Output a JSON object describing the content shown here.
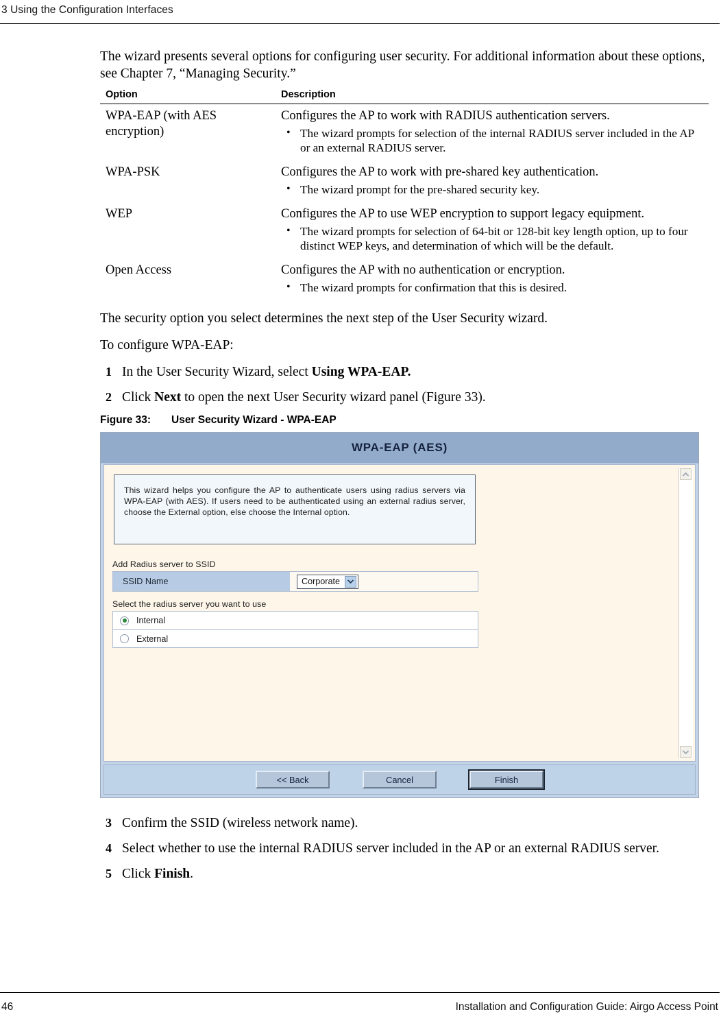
{
  "header": {
    "chapter_number": "3",
    "chapter_title": "Using the Configuration Interfaces",
    "full": "3  Using the Configuration Interfaces"
  },
  "intro": {
    "paragraph": "The wizard presents several options for configuring user security. For additional information about these options, see Chapter 7,  “Managing Security.”"
  },
  "options_table": {
    "headers": {
      "option": "Option",
      "description": "Description"
    },
    "rows": [
      {
        "option": "WPA-EAP (with AES encryption)",
        "description_lead": "Configures the AP to work with RADIUS authentication servers.",
        "bullets": [
          "The wizard prompts for selection of the internal RADIUS server included in the AP or an external RADIUS server."
        ]
      },
      {
        "option": "WPA-PSK",
        "description_lead": "Configures the AP to work with pre-shared key authentication.",
        "bullets": [
          "The wizard prompt for the pre-shared security key."
        ]
      },
      {
        "option": "WEP",
        "description_lead": "Configures the AP to use WEP encryption to support legacy equipment.",
        "bullets": [
          "The wizard prompts for selection of 64-bit or 128-bit key length option, up to four distinct WEP keys, and determination of which will be the default."
        ]
      },
      {
        "option": "Open Access",
        "description_lead": "Configures the AP with no authentication or encryption.",
        "bullets": [
          "The wizard prompts for confirmation that this is desired."
        ]
      }
    ]
  },
  "after_table": {
    "paragraph": "The security option you select determines the next step of the User Security wizard.",
    "lead_in": "To configure WPA-EAP:"
  },
  "steps_before_figure": [
    {
      "num": "1",
      "text_before": "In the User Security Wizard, select ",
      "bold": "Using WPA-EAP.",
      "text_after": ""
    },
    {
      "num": "2",
      "text_before": "Click ",
      "bold": "Next",
      "text_after": " to open the next User Security wizard panel (Figure 33)."
    }
  ],
  "figure": {
    "caption_label": "Figure 33:",
    "caption_title": "User Security Wizard - WPA-EAP",
    "wizard": {
      "title": "WPA-EAP (AES)",
      "instruction": "This wizard helps you configure the AP to authenticate users using radius servers via WPA-EAP (with AES). If users need to be authenticated using an external radius server, choose the External option, else choose the Internal option.",
      "ssid_group": {
        "label": "Add Radius server to SSID",
        "field_label": "SSID Name",
        "selected_value": "Corporate",
        "options": [
          "Corporate"
        ]
      },
      "radius_group": {
        "label": "Select the radius server you want to use",
        "options": [
          {
            "label": "Internal",
            "selected": true
          },
          {
            "label": "External",
            "selected": false
          }
        ]
      },
      "buttons": [
        {
          "label": "<< Back",
          "focused": false
        },
        {
          "label": "Cancel",
          "focused": false
        },
        {
          "label": "Finish",
          "focused": true
        }
      ],
      "scrollbar": {
        "up_icon": "chevron-up-icon",
        "down_icon": "chevron-down-icon"
      },
      "colors": {
        "titlebar": "#93abcb",
        "body": "#fdf6e9",
        "frame": "#c3d3e8",
        "instruction_box": "#f2f7fb",
        "field_label": "#b7cce4",
        "buttonbar": "#bed2e8",
        "radio_selected": "#2f8a3e"
      }
    }
  },
  "steps_after_figure": [
    {
      "num": "3",
      "text_before": "Confirm the SSID (wireless network name).",
      "bold": "",
      "text_after": ""
    },
    {
      "num": "4",
      "text_before": "Select whether to use the internal RADIUS server included in the AP or an external RADIUS server.",
      "bold": "",
      "text_after": ""
    },
    {
      "num": "5",
      "text_before": "Click ",
      "bold": "Finish",
      "text_after": "."
    }
  ],
  "footer": {
    "page_number": "46",
    "guide_title": "Installation and Configuration Guide: Airgo Access Point"
  }
}
